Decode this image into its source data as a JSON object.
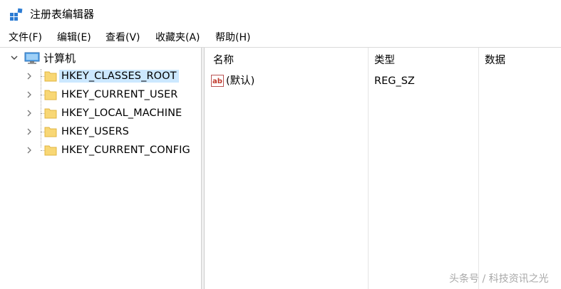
{
  "window": {
    "title": "注册表编辑器",
    "icon": "registry-editor-icon"
  },
  "menubar": {
    "items": [
      "文件(F)",
      "编辑(E)",
      "查看(V)",
      "收藏夹(A)",
      "帮助(H)"
    ]
  },
  "tree": {
    "root": {
      "label": "计算机",
      "icon": "computer-icon",
      "expanded": true
    },
    "nodes": [
      {
        "label": "HKEY_CLASSES_ROOT",
        "icon": "folder-icon",
        "selected": true
      },
      {
        "label": "HKEY_CURRENT_USER",
        "icon": "folder-icon",
        "selected": false
      },
      {
        "label": "HKEY_LOCAL_MACHINE",
        "icon": "folder-icon",
        "selected": false
      },
      {
        "label": "HKEY_USERS",
        "icon": "folder-icon",
        "selected": false
      },
      {
        "label": "HKEY_CURRENT_CONFIG",
        "icon": "folder-icon",
        "selected": false
      }
    ]
  },
  "list": {
    "columns": [
      "名称",
      "类型",
      "数据"
    ],
    "rows": [
      {
        "name": "(默认)",
        "type": "REG_SZ",
        "data": "",
        "icon": "string-value-icon"
      }
    ]
  },
  "watermark": "头条号 / 科技资讯之光",
  "colors": {
    "selection": "#cce8ff",
    "folder": "#f8d775",
    "folder_dark": "#e0b440",
    "border": "#cfcfcf"
  }
}
